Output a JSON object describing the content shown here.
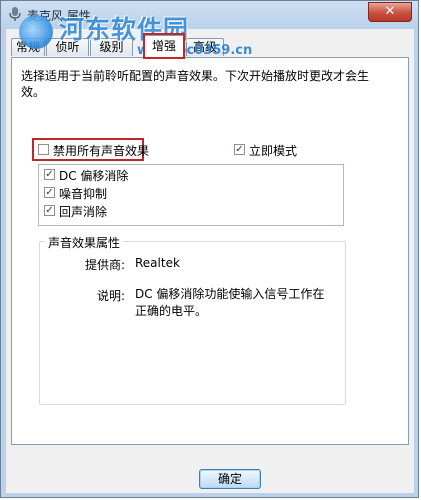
{
  "window": {
    "title": "麦克风 属性",
    "close_glyph": "✕"
  },
  "watermark": {
    "text": "河东软件园",
    "url": "www.pc0359.cn"
  },
  "tabs": [
    {
      "label": "常规"
    },
    {
      "label": "侦听"
    },
    {
      "label": "级别"
    },
    {
      "label": "增强"
    },
    {
      "label": "高级"
    }
  ],
  "active_tab": "增强",
  "enhance": {
    "description": "选择适用于当前聆听配置的声音效果。下次开始播放时更改才会生效。",
    "disable_all": {
      "label": "禁用所有声音效果",
      "checked": false
    },
    "immediate_mode": {
      "label": "立即模式",
      "checked": true
    },
    "effects": [
      {
        "label": "DC 偏移消除",
        "checked": true
      },
      {
        "label": "噪音抑制",
        "checked": true
      },
      {
        "label": "回声消除",
        "checked": true
      }
    ],
    "properties": {
      "title": "声音效果属性",
      "provider_label": "提供商:",
      "provider_value": "Realtek",
      "description_label": "说明:",
      "description_value": "DC 偏移消除功能使输入信号工作在正确的电平。"
    }
  },
  "buttons": {
    "ok": "确定"
  },
  "colors": {
    "highlight": "#c0272d",
    "accent": "#2f86d6"
  }
}
